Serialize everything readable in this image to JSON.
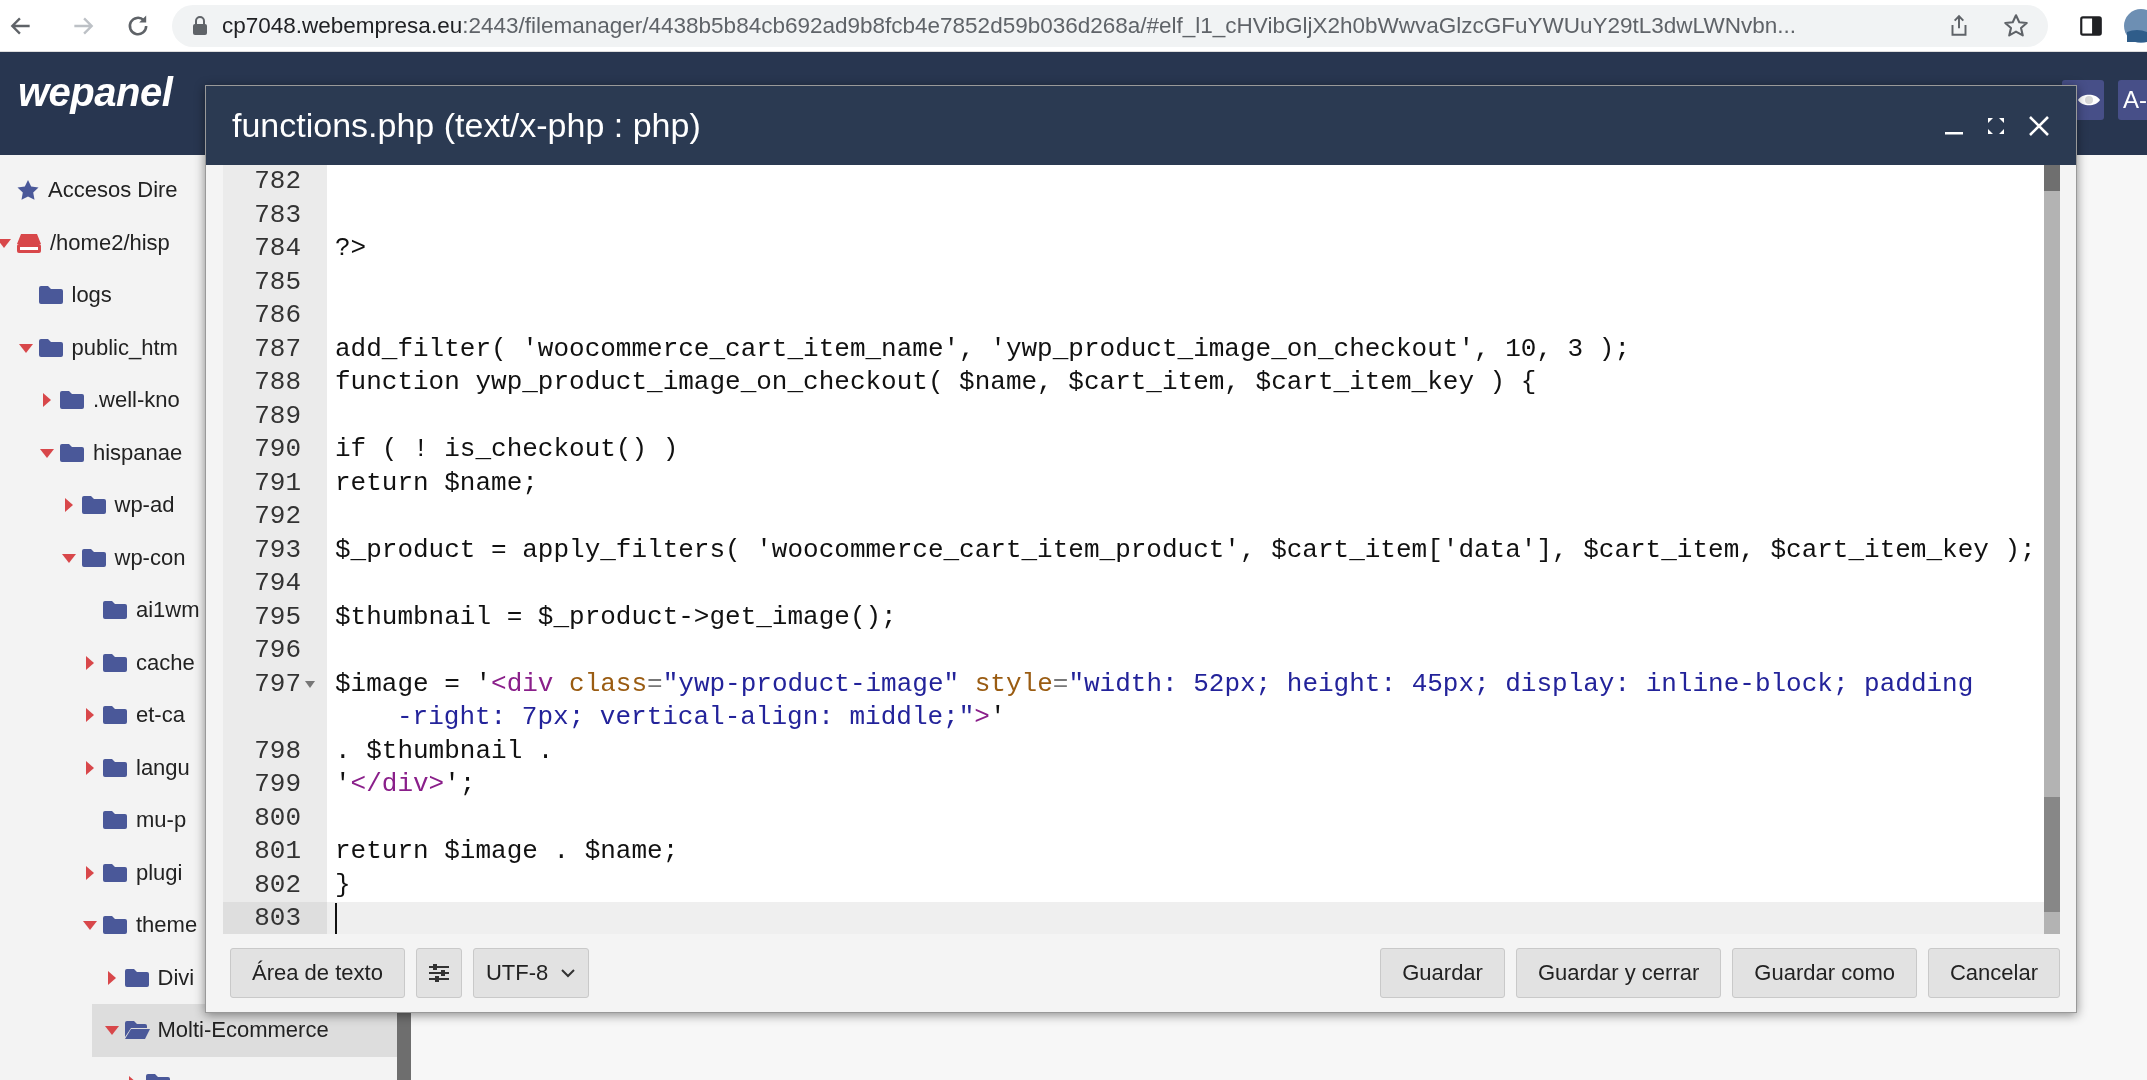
{
  "browser": {
    "url_host": "cp7048.webempresa.eu",
    "url_rest": ":2443/filemanager/4438b5b84cb692ad9b8fcb4e7852d59b036d268a/#elf_l1_cHVibGljX2h0bWwvaGlzcGFuYWUuY29tL3dwLWNvbn...",
    "forward_disabled": true
  },
  "header": {
    "logo": "wepanel",
    "right_button": "A-"
  },
  "sidebar": {
    "tree": [
      {
        "label": "Accesos Dire",
        "kind": "shortcut",
        "selected": false
      },
      {
        "label": "/home2/hisp",
        "kind": "drive",
        "expanded": true,
        "selected": false,
        "children": [
          {
            "label": "logs",
            "kind": "folder",
            "selected": false
          },
          {
            "label": "public_htm",
            "kind": "folder",
            "expanded": true,
            "selected": false,
            "children": [
              {
                "label": ".well-kno",
                "kind": "folder",
                "expanded": false,
                "selected": false
              },
              {
                "label": "hispanae",
                "kind": "folder",
                "expanded": true,
                "selected": false,
                "children": [
                  {
                    "label": "wp-ad",
                    "kind": "folder",
                    "expanded": false,
                    "selected": false
                  },
                  {
                    "label": "wp-con",
                    "kind": "folder",
                    "expanded": true,
                    "selected": false,
                    "children": [
                      {
                        "label": "ai1wm",
                        "kind": "folder",
                        "selected": false
                      },
                      {
                        "label": "cache",
                        "kind": "folder",
                        "expanded": false,
                        "selected": false
                      },
                      {
                        "label": "et-ca",
                        "kind": "folder",
                        "expanded": false,
                        "selected": false
                      },
                      {
                        "label": "langu",
                        "kind": "folder",
                        "expanded": false,
                        "selected": false
                      },
                      {
                        "label": "mu-p",
                        "kind": "folder",
                        "selected": false
                      },
                      {
                        "label": "plugi",
                        "kind": "folder",
                        "expanded": false,
                        "selected": false
                      },
                      {
                        "label": "theme",
                        "kind": "folder",
                        "expanded": true,
                        "selected": false,
                        "children": [
                          {
                            "label": "Divi",
                            "kind": "folder",
                            "expanded": false,
                            "selected": false
                          },
                          {
                            "label": "Molti-Ecommerce",
                            "kind": "folder",
                            "expanded": true,
                            "selected": true,
                            "children": [
                              {
                                "kind": "folder",
                                "expanded": false,
                                "selected": false
                              }
                            ]
                          }
                        ]
                      }
                    ]
                  }
                ]
              }
            ]
          }
        ]
      }
    ]
  },
  "dialog": {
    "title": "functions.php (text/x-php : php)",
    "lines": [
      {
        "number": "782",
        "active": false,
        "foldable": false
      },
      {
        "number": "783",
        "active": false,
        "foldable": false
      },
      {
        "number": "784",
        "active": false,
        "foldable": false,
        "segments": [
          {
            "kind": "plain",
            "text": "?>"
          }
        ]
      },
      {
        "number": "785",
        "active": false,
        "foldable": false
      },
      {
        "number": "786",
        "active": false,
        "foldable": false
      },
      {
        "number": "787",
        "active": false,
        "foldable": false,
        "segments": [
          {
            "kind": "plain",
            "text": "add_filter( 'woocommerce_cart_item_name', 'ywp_product_image_on_checkout', 10, 3 );"
          }
        ]
      },
      {
        "number": "788",
        "active": false,
        "foldable": false,
        "segments": [
          {
            "kind": "plain",
            "text": "function ywp_product_image_on_checkout( $name, $cart_item, $cart_item_key ) {"
          }
        ]
      },
      {
        "number": "789",
        "active": false,
        "foldable": false
      },
      {
        "number": "790",
        "active": false,
        "foldable": false,
        "segments": [
          {
            "kind": "plain",
            "text": "if ( ! is_checkout() )"
          }
        ]
      },
      {
        "number": "791",
        "active": false,
        "foldable": false,
        "segments": [
          {
            "kind": "plain",
            "text": "return $name;"
          }
        ]
      },
      {
        "number": "792",
        "active": false,
        "foldable": false
      },
      {
        "number": "793",
        "active": false,
        "foldable": false,
        "segments": [
          {
            "kind": "plain",
            "text": "$_product = apply_filters( 'woocommerce_cart_item_product', $cart_item['data'], $cart_item, $cart_item_key );"
          }
        ]
      },
      {
        "number": "794",
        "active": false,
        "foldable": false
      },
      {
        "number": "795",
        "active": false,
        "foldable": false,
        "segments": [
          {
            "kind": "plain",
            "text": "$thumbnail = $_product->get_image();"
          }
        ]
      },
      {
        "number": "796",
        "active": false,
        "foldable": false
      },
      {
        "number": "797",
        "active": false,
        "foldable": true,
        "segments": [
          {
            "kind": "plain",
            "text": "$image = '"
          },
          {
            "kind": "tag",
            "text": "<div"
          },
          {
            "kind": "attr",
            "text": " class"
          },
          {
            "kind": "op",
            "text": "="
          },
          {
            "kind": "string",
            "text": "\"ywp-product-image\""
          },
          {
            "kind": "attr",
            "text": " style"
          },
          {
            "kind": "op",
            "text": "="
          },
          {
            "kind": "string",
            "text": "\"width: 52px; height: 45px; display: inline-block; padding"
          }
        ],
        "continuation": [
          {
            "kind": "string",
            "text": "-right: 7px; vertical-align: middle;\""
          },
          {
            "kind": "tag",
            "text": ">"
          },
          {
            "kind": "plain",
            "text": "'"
          }
        ]
      },
      {
        "number": "798",
        "active": false,
        "foldable": false,
        "segments": [
          {
            "kind": "plain",
            "text": ". $thumbnail ."
          }
        ]
      },
      {
        "number": "799",
        "active": false,
        "foldable": false,
        "segments": [
          {
            "kind": "plain",
            "text": "'"
          },
          {
            "kind": "tag",
            "text": "</div>"
          },
          {
            "kind": "plain",
            "text": "';"
          }
        ]
      },
      {
        "number": "800",
        "active": false,
        "foldable": false
      },
      {
        "number": "801",
        "active": false,
        "foldable": false,
        "segments": [
          {
            "kind": "plain",
            "text": "return $image . $name;"
          }
        ]
      },
      {
        "number": "802",
        "active": false,
        "foldable": false,
        "segments": [
          {
            "kind": "plain",
            "text": "}"
          }
        ]
      },
      {
        "number": "803",
        "active": true,
        "foldable": false
      }
    ],
    "footer": {
      "mode_button": "Área de texto",
      "encoding": "UTF-8",
      "buttons": [
        "Guardar",
        "Guardar y cerrar",
        "Guardar como",
        "Cancelar"
      ]
    }
  }
}
